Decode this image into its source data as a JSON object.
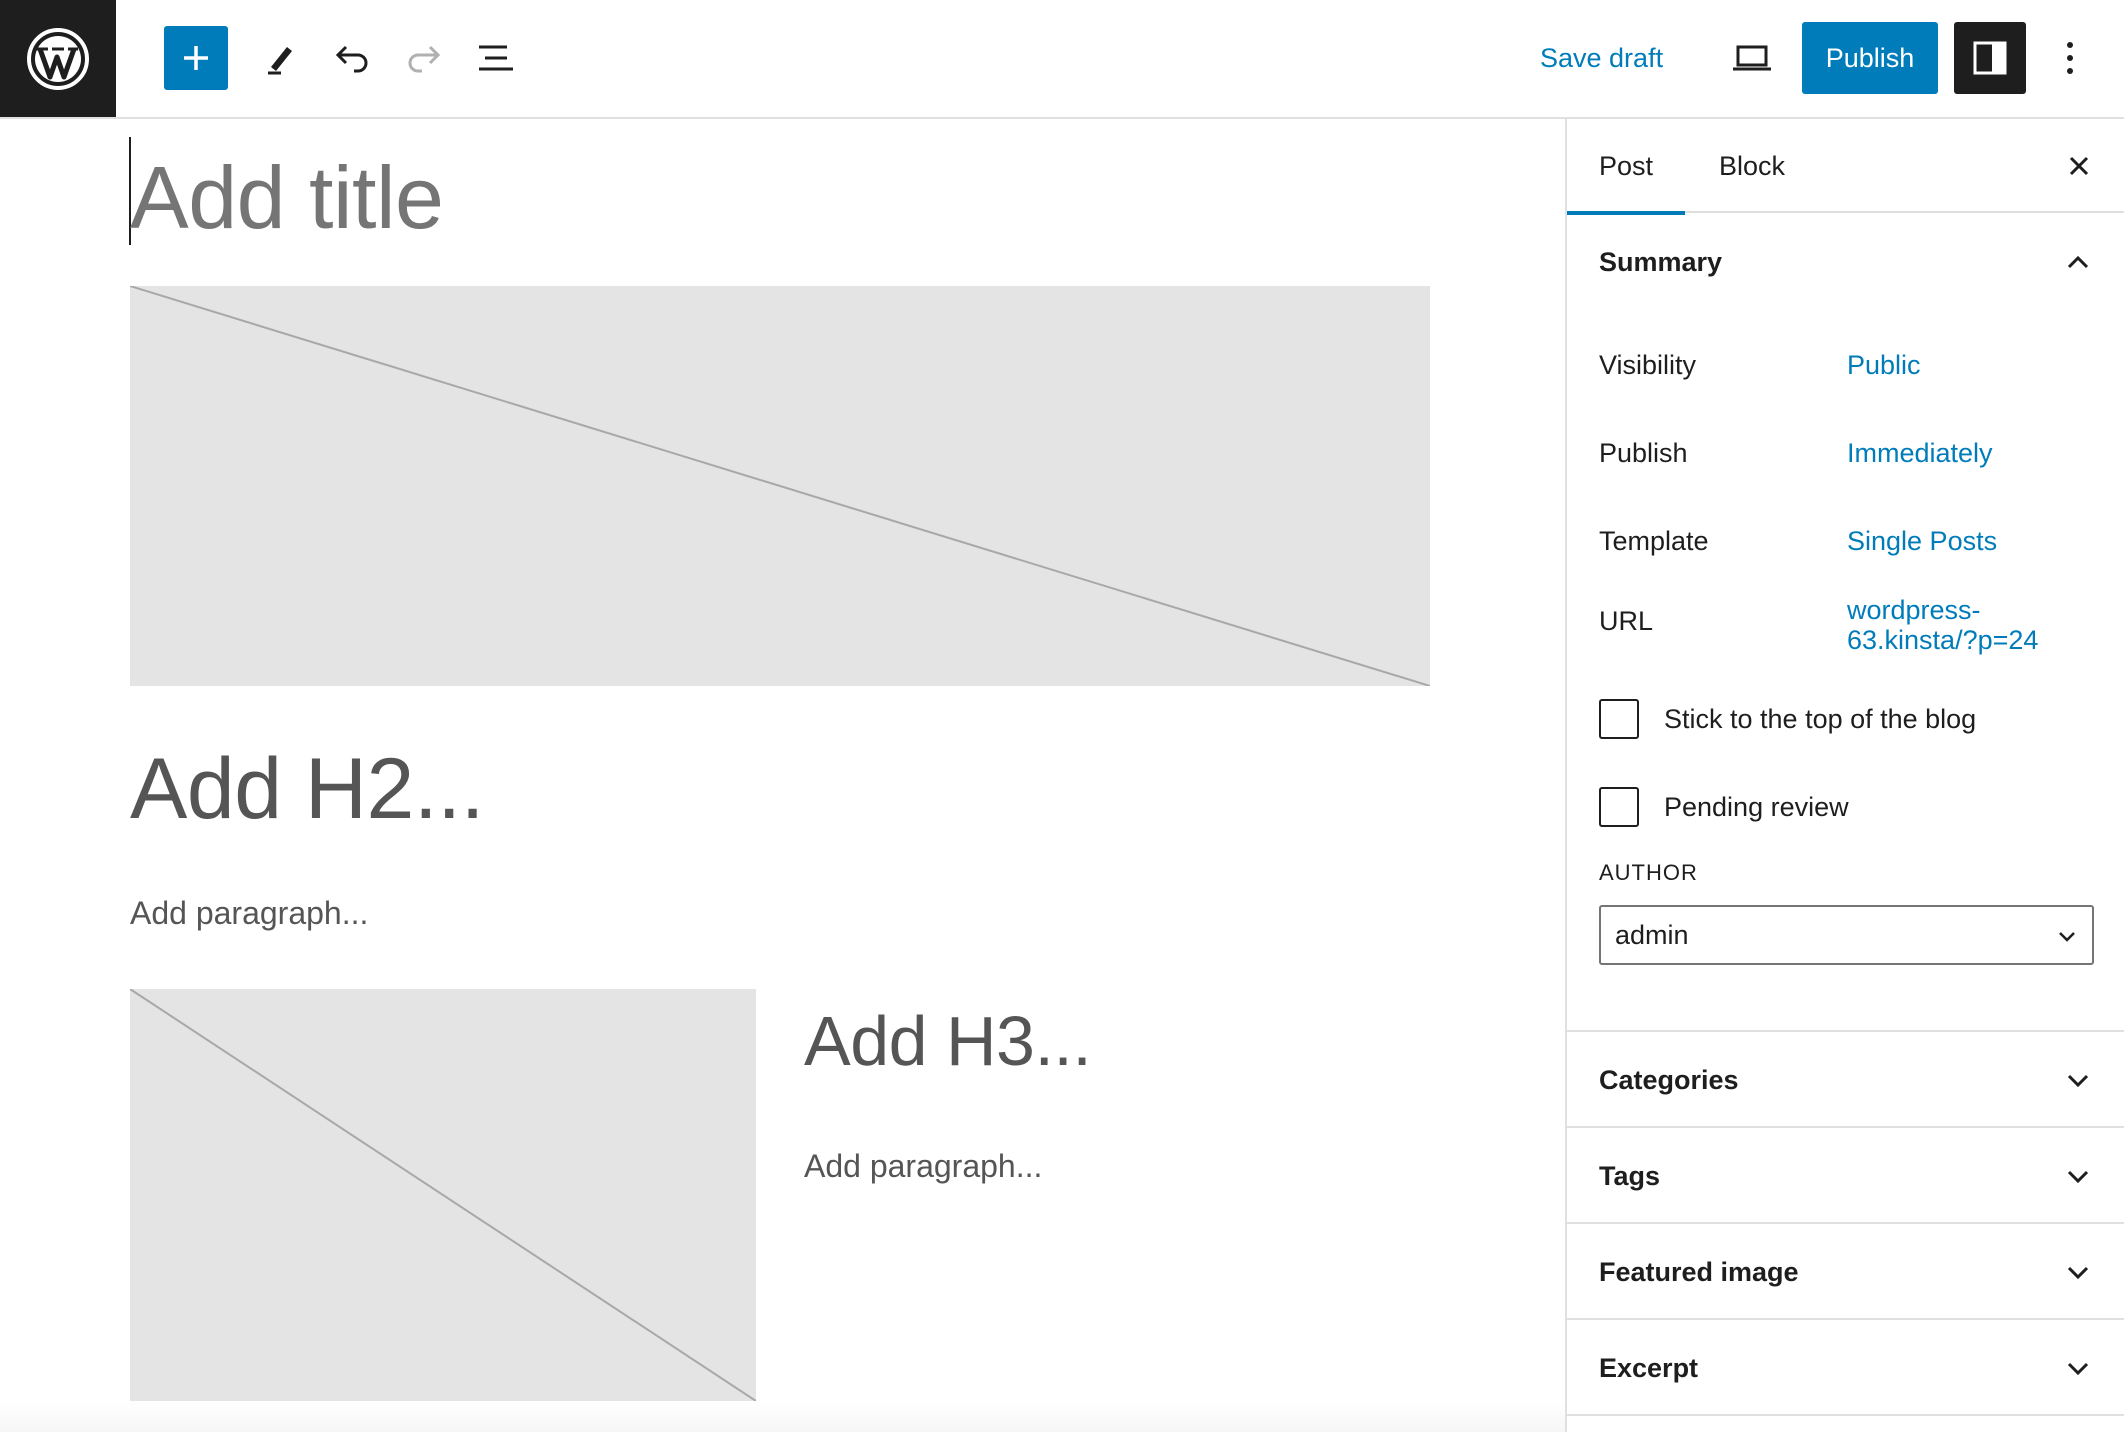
{
  "toolbar": {
    "add_icon": "plus-icon",
    "tools_icon": "pencil-icon",
    "undo_icon": "undo-icon",
    "redo_icon": "redo-icon",
    "list_view_icon": "list-view-icon",
    "save_draft_label": "Save draft",
    "preview_icon": "laptop-icon",
    "publish_label": "Publish",
    "settings_icon": "sidebar-toggle-icon",
    "more_icon": "vertical-ellipsis-icon"
  },
  "editor": {
    "title_placeholder": "Add title",
    "h2_placeholder": "Add H2...",
    "paragraph_placeholder_1": "Add paragraph...",
    "h3_placeholder": "Add H3...",
    "paragraph_placeholder_2": "Add paragraph..."
  },
  "sidebar": {
    "tabs": [
      {
        "label": "Post",
        "active": true
      },
      {
        "label": "Block",
        "active": false
      }
    ],
    "summary": {
      "heading": "Summary",
      "rows": [
        {
          "label": "Visibility",
          "value": "Public"
        },
        {
          "label": "Publish",
          "value": "Immediately"
        },
        {
          "label": "Template",
          "value": "Single Posts"
        },
        {
          "label": "URL",
          "value": "wordpress-63.kinsta/?p=24"
        }
      ],
      "checkboxes": [
        {
          "label": "Stick to the top of the blog",
          "checked": false
        },
        {
          "label": "Pending review",
          "checked": false
        }
      ],
      "author_label": "AUTHOR",
      "author_value": "admin"
    },
    "panels": [
      {
        "label": "Categories"
      },
      {
        "label": "Tags"
      },
      {
        "label": "Featured image"
      },
      {
        "label": "Excerpt"
      }
    ]
  },
  "colors": {
    "accent": "#007cba",
    "dark": "#1e1e1e",
    "placeholder_bg": "#e4e4e4"
  }
}
